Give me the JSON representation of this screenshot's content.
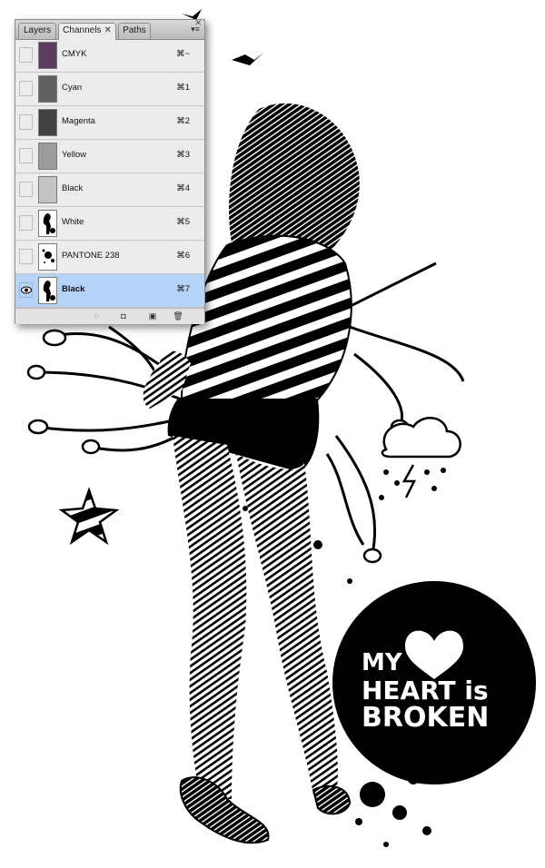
{
  "panel": {
    "tabs": [
      "Layers",
      "Channels",
      "Paths"
    ],
    "active_tab": "Channels",
    "menu_icon": "panel-menu-icon",
    "channels": [
      {
        "name": "CMYK",
        "shortcut": "⌘~",
        "visible": false,
        "selected": false,
        "thumb": "#5c3d60"
      },
      {
        "name": "Cyan",
        "shortcut": "⌘1",
        "visible": false,
        "selected": false,
        "thumb": "#616161"
      },
      {
        "name": "Magenta",
        "shortcut": "⌘2",
        "visible": false,
        "selected": false,
        "thumb": "#424242"
      },
      {
        "name": "Yellow",
        "shortcut": "⌘3",
        "visible": false,
        "selected": false,
        "thumb": "#9c9c9c"
      },
      {
        "name": "Black",
        "shortcut": "⌘4",
        "visible": false,
        "selected": false,
        "thumb": "#c4c4c4"
      },
      {
        "name": "White",
        "shortcut": "⌘5",
        "visible": false,
        "selected": false,
        "thumb": "figure"
      },
      {
        "name": "PANTONE 238",
        "shortcut": "⌘6",
        "visible": false,
        "selected": false,
        "thumb": "splatter"
      },
      {
        "name": "Black",
        "shortcut": "⌘7",
        "visible": true,
        "selected": true,
        "thumb": "figure"
      }
    ],
    "footer_buttons": [
      "load-selection-icon",
      "save-selection-icon",
      "new-channel-icon",
      "trash-icon"
    ]
  },
  "artwork": {
    "badge_text": [
      "MY",
      "HEART is",
      "BROKEN"
    ],
    "colors": {
      "ink": "#000000",
      "paper": "#ffffff",
      "selection": "#b5d3f7"
    }
  }
}
